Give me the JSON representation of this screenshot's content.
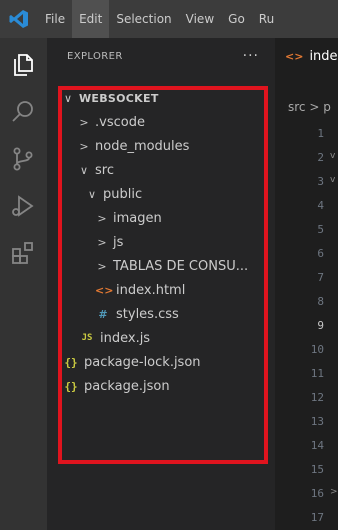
{
  "menu": {
    "items": [
      "File",
      "Edit",
      "Selection",
      "View",
      "Go",
      "Ru"
    ]
  },
  "activity_bar": {
    "icons": [
      "explorer-icon",
      "search-icon",
      "source-control-icon",
      "run-debug-icon",
      "extensions-icon"
    ]
  },
  "explorer": {
    "title": "EXPLORER",
    "more": "···",
    "root": "WEBSOCKET",
    "items": [
      {
        "label": ".vscode",
        "type": "folder",
        "expanded": false
      },
      {
        "label": "node_modules",
        "type": "folder",
        "expanded": false
      },
      {
        "label": "src",
        "type": "folder",
        "expanded": true
      },
      {
        "label": "public",
        "type": "folder",
        "expanded": true
      },
      {
        "label": "imagen",
        "type": "folder",
        "expanded": false
      },
      {
        "label": "js",
        "type": "folder",
        "expanded": false
      },
      {
        "label": "TABLAS DE CONSU...",
        "type": "folder",
        "expanded": false
      },
      {
        "label": "index.html",
        "type": "html"
      },
      {
        "label": "styles.css",
        "type": "css"
      },
      {
        "label": "index.js",
        "type": "js"
      },
      {
        "label": "package-lock.json",
        "type": "json"
      },
      {
        "label": "package.json",
        "type": "json"
      }
    ],
    "highlight_color": "#e0141e"
  },
  "editor": {
    "tab_label": "inde",
    "breadcrumb": "src > p",
    "current_line": "9",
    "line_numbers": [
      "1",
      "2",
      "3",
      "4",
      "5",
      "6",
      "7",
      "8",
      "9",
      "10",
      "11",
      "12",
      "13",
      "14",
      "15",
      "16",
      "17"
    ]
  },
  "icons": {
    "chevron_down": "∨",
    "chevron_right": ">",
    "html": "<>",
    "css": "#",
    "js": "JS",
    "json": "{}"
  }
}
